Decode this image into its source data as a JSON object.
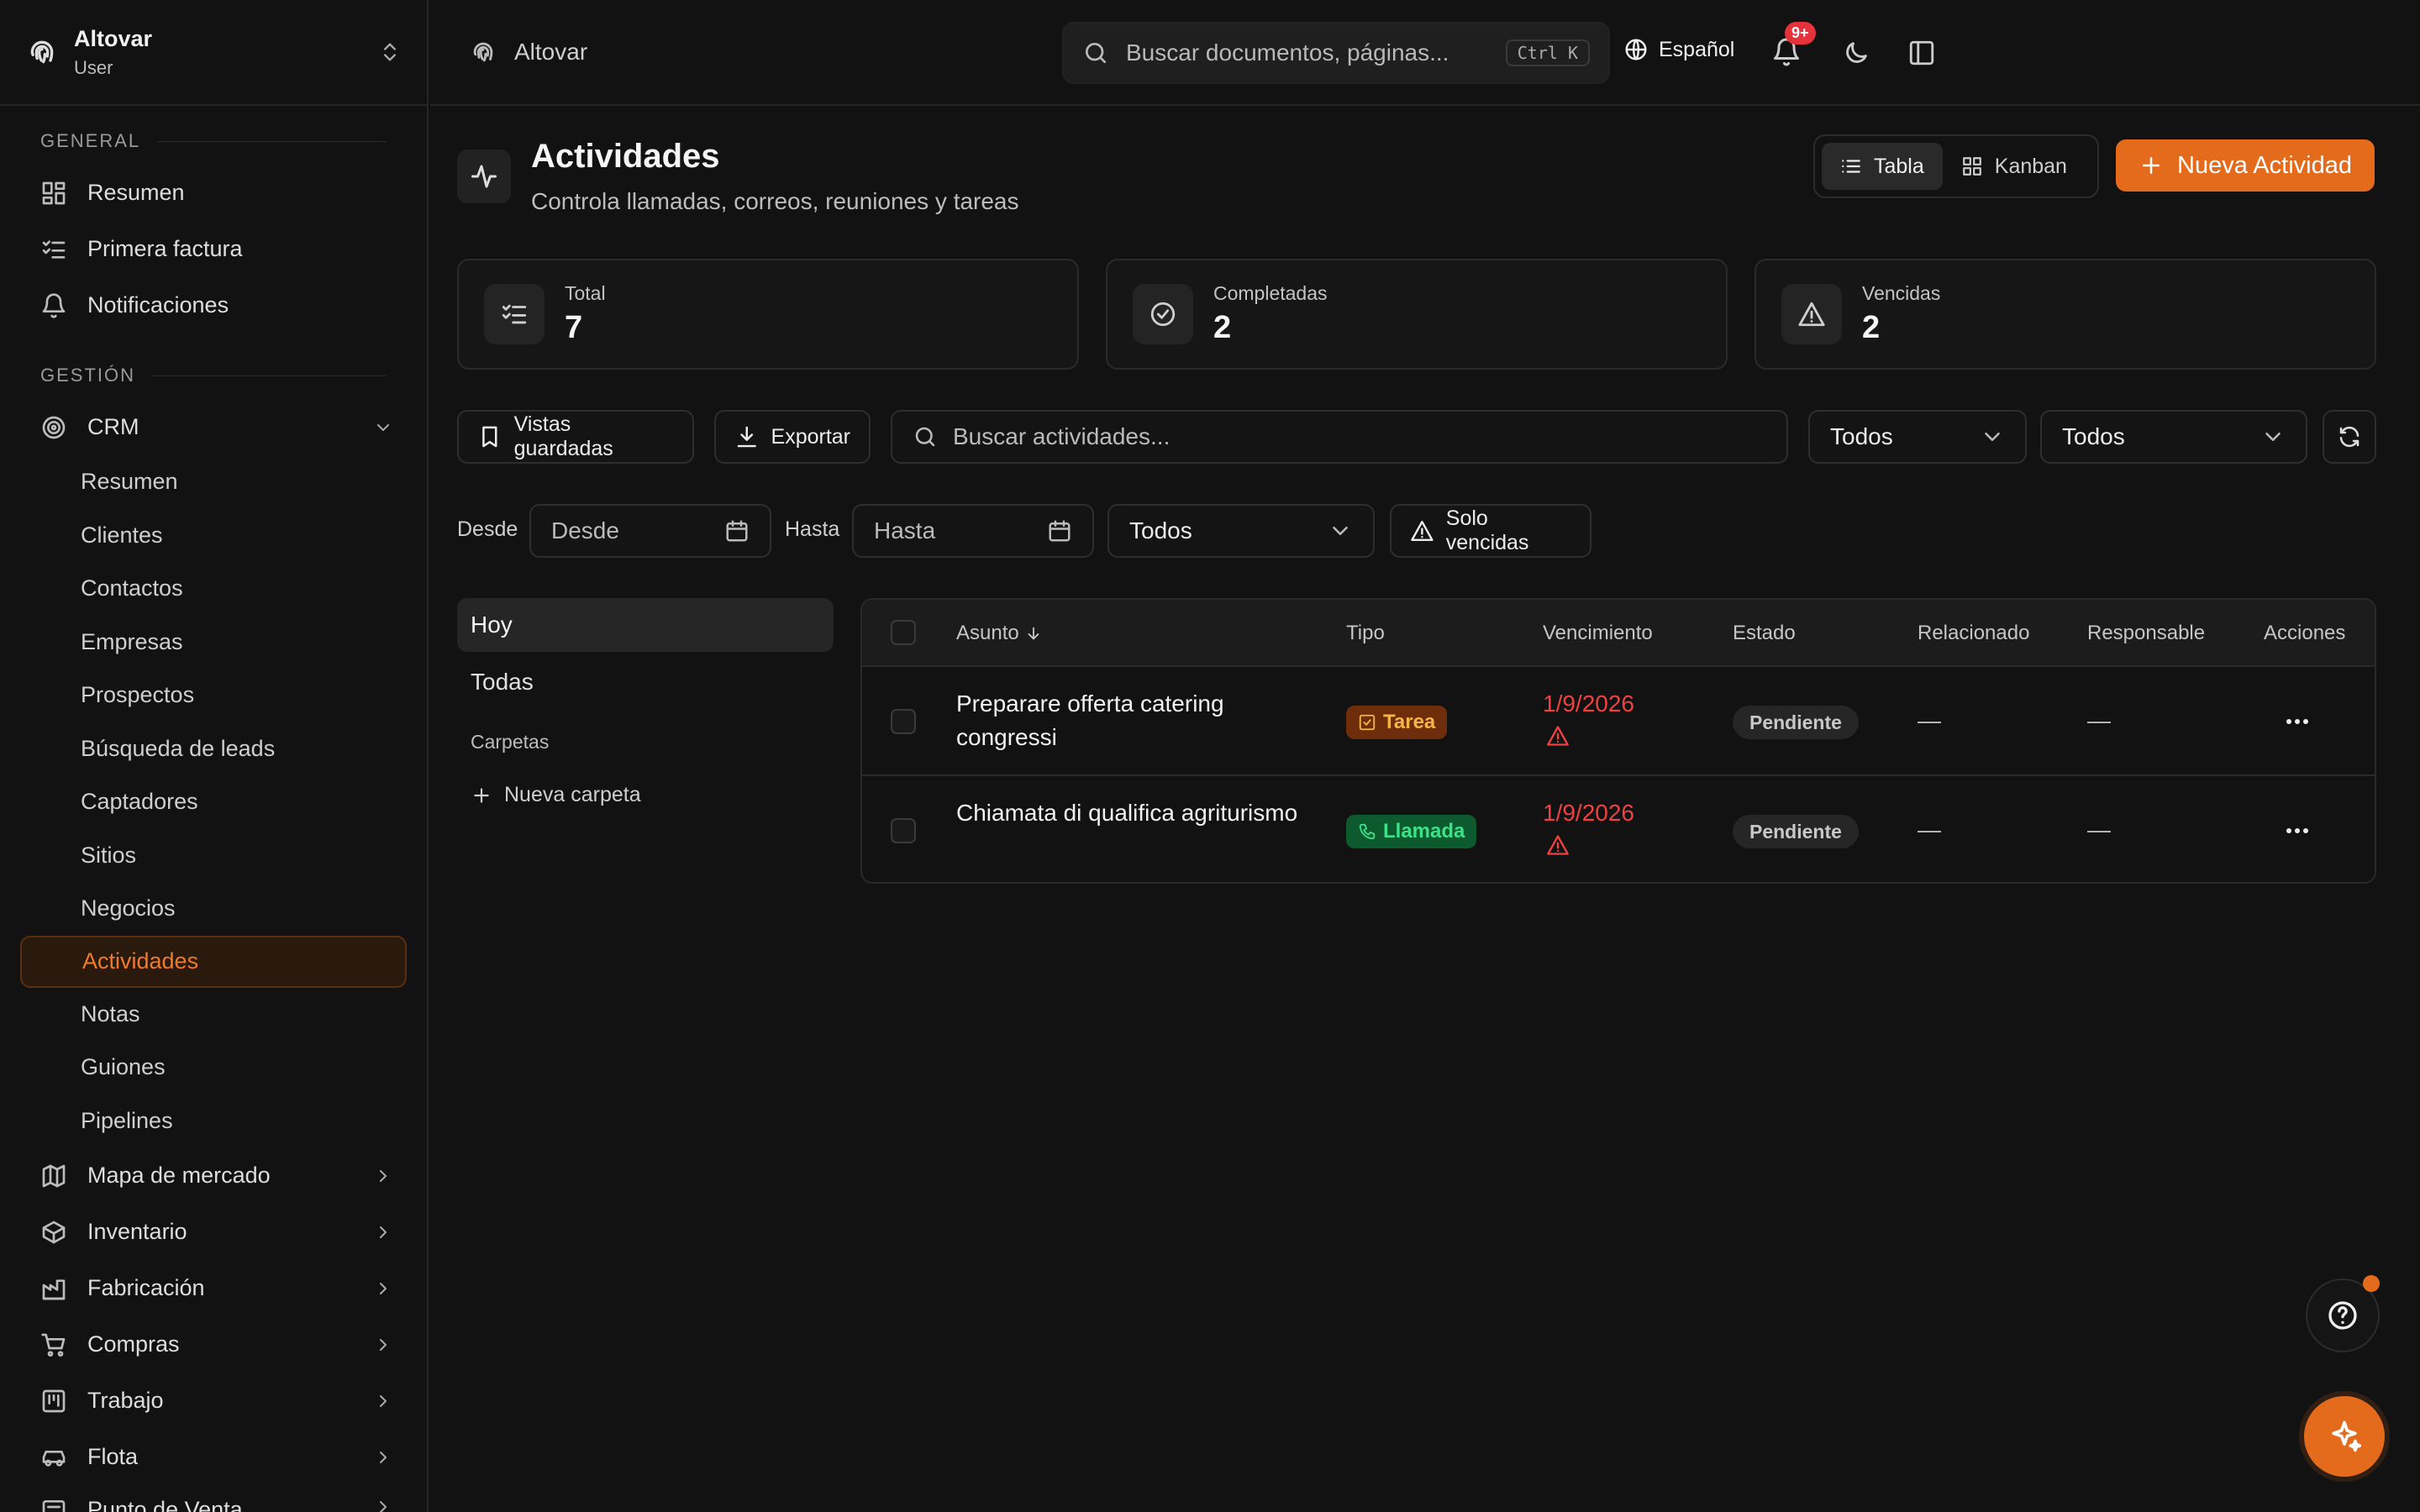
{
  "sidebar": {
    "org_name": "Altovar",
    "org_role": "User",
    "section_general": "GENERAL",
    "general_items": [
      {
        "label": "Resumen",
        "icon": "dashboard-icon"
      },
      {
        "label": "Primera factura",
        "icon": "checklist-icon"
      },
      {
        "label": "Notificaciones",
        "icon": "bell-icon"
      }
    ],
    "section_gestion": "GESTIÓN",
    "crm_label": "CRM",
    "crm_items": [
      "Resumen",
      "Clientes",
      "Contactos",
      "Empresas",
      "Prospectos",
      "Búsqueda de leads",
      "Captadores",
      "Sitios",
      "Negocios",
      "Actividades",
      "Notas",
      "Guiones",
      "Pipelines"
    ],
    "active_item": "Actividades",
    "groups": [
      {
        "label": "Mapa de mercado",
        "icon": "map-icon"
      },
      {
        "label": "Inventario",
        "icon": "box-icon"
      },
      {
        "label": "Fabricación",
        "icon": "factory-icon"
      },
      {
        "label": "Compras",
        "icon": "cart-icon"
      },
      {
        "label": "Trabajo",
        "icon": "kanban-icon"
      },
      {
        "label": "Flota",
        "icon": "car-icon"
      },
      {
        "label": "Punto de Venta",
        "icon": "register-icon"
      }
    ]
  },
  "topbar": {
    "breadcrumb": "Altovar",
    "search_placeholder": "Buscar documentos, páginas...",
    "shortcut": "Ctrl K",
    "language": "Español",
    "notif_count": "9+"
  },
  "page": {
    "title": "Actividades",
    "subtitle": "Controla llamadas, correos, reuniones y tareas",
    "view_table": "Tabla",
    "view_kanban": "Kanban",
    "new_button": "Nueva Actividad"
  },
  "stats": [
    {
      "label": "Total",
      "value": "7",
      "icon": "checklist-icon"
    },
    {
      "label": "Completadas",
      "value": "2",
      "icon": "check-circle-icon"
    },
    {
      "label": "Vencidas",
      "value": "2",
      "icon": "warning-icon"
    }
  ],
  "filters": {
    "saved_views": "Vistas guardadas",
    "export": "Exportar",
    "search_placeholder": "Buscar actividades...",
    "type_select": "Todos",
    "status_select": "Todos",
    "from_label": "Desde",
    "from_placeholder": "Desde",
    "to_label": "Hasta",
    "to_placeholder": "Hasta",
    "scope_select": "Todos",
    "overdue_only": "Solo vencidas"
  },
  "folders": {
    "today": "Hoy",
    "all": "Todas",
    "folders_heading": "Carpetas",
    "new_folder": "Nueva carpeta"
  },
  "table": {
    "columns": {
      "subject": "Asunto",
      "type": "Tipo",
      "due": "Vencimiento",
      "status": "Estado",
      "related": "Relacionado",
      "owner": "Responsable",
      "actions": "Acciones"
    },
    "rows": [
      {
        "subject": "Preparare offerta catering congressi",
        "type": "Tarea",
        "due": "1/9/2026",
        "status": "Pendiente",
        "related": "—",
        "owner": "—"
      },
      {
        "subject": "Chiamata di qualifica agriturismo",
        "type": "Llamada",
        "due": "1/9/2026",
        "status": "Pendiente",
        "related": "—",
        "owner": "—"
      }
    ]
  },
  "colors": {
    "accent": "#e46a1c",
    "danger": "#f04040",
    "tag_tarea_bg": "#6e2e0c",
    "tag_llamada_bg": "#0d5a2e"
  }
}
